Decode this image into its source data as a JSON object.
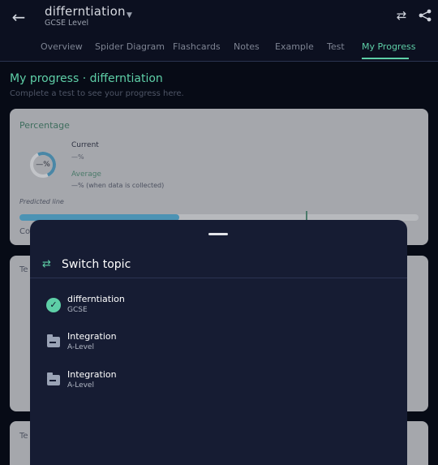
{
  "header": {
    "title": "differntiation",
    "subtitle": "GCSE Level",
    "icons": {
      "back": "back-arrow-icon",
      "swap": "swap-icon",
      "share": "share-icon",
      "dropdown": "chevron-down-icon"
    }
  },
  "tabs": [
    {
      "label": "Overview",
      "active": false
    },
    {
      "label": "Spider Diagram",
      "active": false
    },
    {
      "label": "Flashcards",
      "active": false
    },
    {
      "label": "Notes",
      "active": false
    },
    {
      "label": "Example",
      "active": false
    },
    {
      "label": "Test",
      "active": false
    },
    {
      "label": "My Progress",
      "active": true
    }
  ],
  "page": {
    "title": "My progress · differntiation",
    "subtitle": "Complete a test to see your progress here."
  },
  "percentage_card": {
    "title": "Percentage",
    "ring_value": "—%",
    "current_label": "Current",
    "current_value": "—%",
    "average_label": "Average",
    "average_value": "—% (when data is collected)",
    "predicted_label": "Predicted line",
    "progress_fraction": 0.4,
    "stub_label": "Co"
  },
  "card2": {
    "stub_label": "Te"
  },
  "card3": {
    "stub_label": "Te"
  },
  "sheet": {
    "title": "Switch topic",
    "items": [
      {
        "name": "differntiation",
        "level": "GCSE",
        "icon": "check-circle-icon",
        "selected": true
      },
      {
        "name": "Integration",
        "level": "A-Level",
        "icon": "folder-icon",
        "selected": false
      },
      {
        "name": "Integration",
        "level": "A-Level",
        "icon": "folder-icon",
        "selected": false
      }
    ]
  },
  "colors": {
    "accent": "#5ecfa7",
    "sheet": "#161c33",
    "card": "#a5a7ac",
    "bar": "#4c93b4"
  }
}
